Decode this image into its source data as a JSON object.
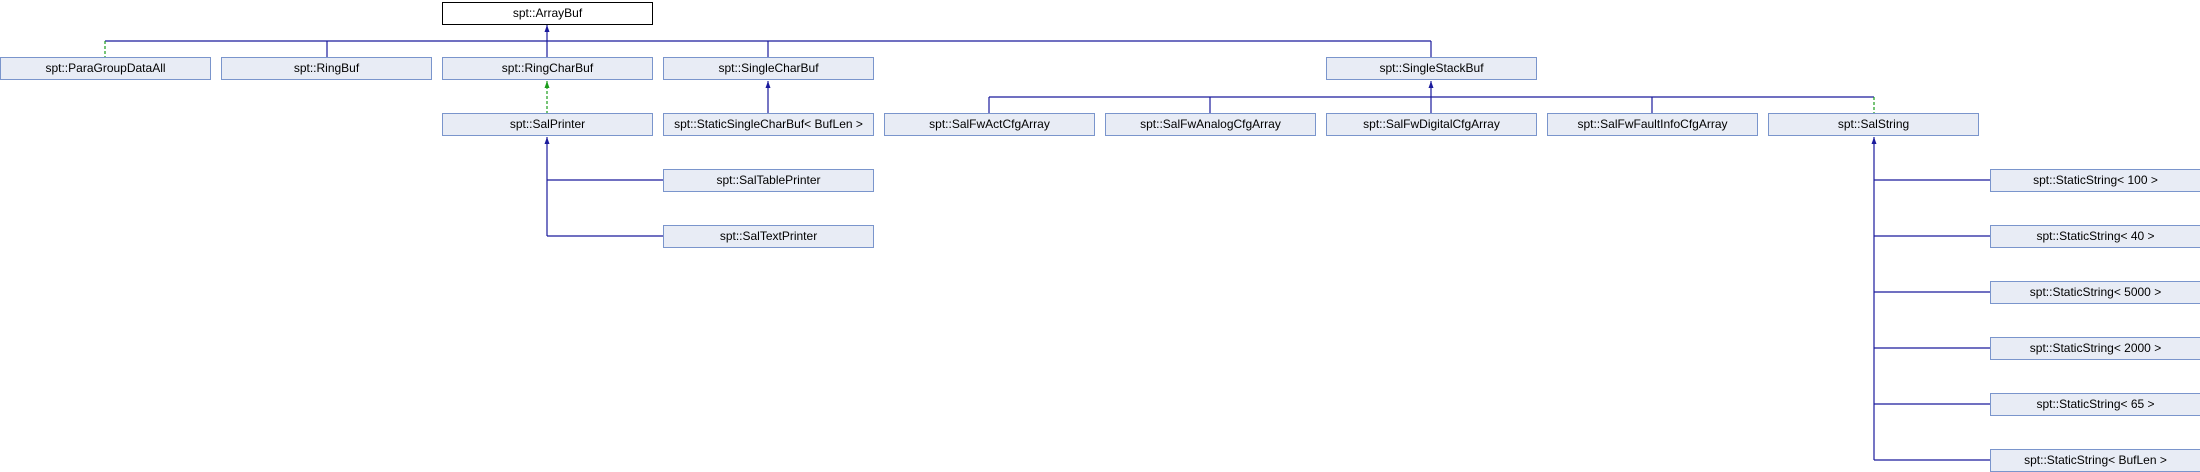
{
  "colors": {
    "edge": "#1a1a9c",
    "template_edge": "#1a9c1a",
    "node_fill": "#e8ecf5",
    "node_border": "#7a95cc"
  },
  "nodes": {
    "arraybuf": "spt::ArrayBuf",
    "paragroupdataall": "spt::ParaGroupDataAll",
    "ringbuf": "spt::RingBuf",
    "ringcharbuf": "spt::RingCharBuf",
    "singlecharbuf": "spt::SingleCharBuf",
    "singlestackbuf": "spt::SingleStackBuf",
    "salprinter": "spt::SalPrinter",
    "staticsinglecharbuf": "spt::StaticSingleCharBuf< BufLen >",
    "salfwactcfgarray": "spt::SalFwActCfgArray",
    "salfwanalogcfgarray": "spt::SalFwAnalogCfgArray",
    "salfwdigitalcfgarray": "spt::SalFwDigitalCfgArray",
    "salfwfaultinfocfgarray": "spt::SalFwFaultInfoCfgArray",
    "salstring": "spt::SalString",
    "saltableprinter": "spt::SalTablePrinter",
    "saltextprinter": "spt::SalTextPrinter",
    "staticstring100": "spt::StaticString< 100 >",
    "staticstring40": "spt::StaticString< 40 >",
    "staticstring5000": "spt::StaticString< 5000 >",
    "staticstring2000": "spt::StaticString< 2000 >",
    "staticstring65": "spt::StaticString< 65 >",
    "staticstringbuflen": "spt::StaticString< BufLen >"
  }
}
